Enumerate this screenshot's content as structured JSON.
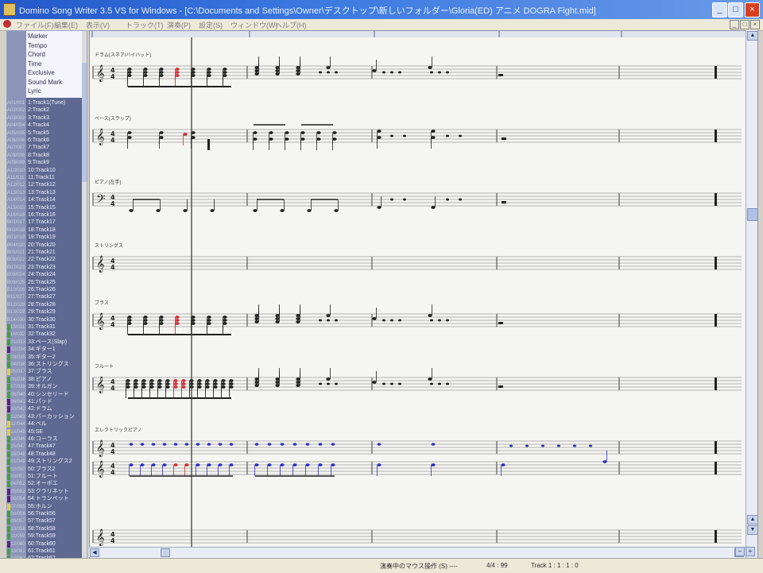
{
  "window": {
    "title": "Domino Song Writer 3.5 VS for Windows - [C:\\Documents and Settings\\Owner\\デスクトップ\\新しいフォルダー\\Gloria(ED) アニメ DOGRA Fight.mid]"
  },
  "window_buttons": {
    "minimize": "_",
    "maximize": "□",
    "close": "×"
  },
  "menu": {
    "items": [
      "ファイル(F)",
      "編集(E)",
      "表示(V)",
      "トラック(T)",
      "演奏(P)",
      "設定(S)",
      "ウィンドウ(W)",
      "ヘルプ(H)"
    ],
    "mdi_buttons": [
      "_",
      "□",
      "×"
    ]
  },
  "conductor": {
    "rows": [
      "Marker",
      "Tempo",
      "Chord",
      "Time",
      "Exclusive",
      "Sound Mark",
      "Lyric"
    ]
  },
  "tracks": [
    {
      "num": "A01/001",
      "label": "1:Track1(Tune)",
      "flag": ""
    },
    {
      "num": "A02/002",
      "label": "2:Track2",
      "flag": ""
    },
    {
      "num": "A03/003",
      "label": "3:Track3",
      "flag": ""
    },
    {
      "num": "A04/004",
      "label": "4:Track4",
      "flag": ""
    },
    {
      "num": "A05/005",
      "label": "5:Track5",
      "flag": ""
    },
    {
      "num": "A06/006",
      "label": "6:Track6",
      "flag": ""
    },
    {
      "num": "A07/007",
      "label": "7:Track7",
      "flag": ""
    },
    {
      "num": "A08/008",
      "label": "8:Track8",
      "flag": ""
    },
    {
      "num": "A09/009",
      "label": "9:Track9",
      "flag": ""
    },
    {
      "num": "A10/010",
      "label": "10:Track10",
      "flag": ""
    },
    {
      "num": "A11/011",
      "label": "11:Track11",
      "flag": ""
    },
    {
      "num": "A12/012",
      "label": "12:Track12",
      "flag": ""
    },
    {
      "num": "A13/013",
      "label": "13:Track13",
      "flag": ""
    },
    {
      "num": "A14/014",
      "label": "14:Track14",
      "flag": ""
    },
    {
      "num": "A15/015",
      "label": "15:Track15",
      "flag": ""
    },
    {
      "num": "A16/016",
      "label": "16:Track16",
      "flag": ""
    },
    {
      "num": "B01/017",
      "label": "17:Track17",
      "flag": ""
    },
    {
      "num": "B02/018",
      "label": "18:Track18",
      "flag": ""
    },
    {
      "num": "B03/019",
      "label": "19:Track19",
      "flag": ""
    },
    {
      "num": "B04/020",
      "label": "20:Track20",
      "flag": ""
    },
    {
      "num": "B05/021",
      "label": "21:Track21",
      "flag": ""
    },
    {
      "num": "B06/022",
      "label": "22:Track22",
      "flag": ""
    },
    {
      "num": "B07/023",
      "label": "23:Track23",
      "flag": ""
    },
    {
      "num": "B08/024",
      "label": "24:Track24",
      "flag": ""
    },
    {
      "num": "B09/025",
      "label": "25:Track25",
      "flag": ""
    },
    {
      "num": "B10/026",
      "label": "26:Track26",
      "flag": ""
    },
    {
      "num": "B11/027",
      "label": "27:Track27",
      "flag": ""
    },
    {
      "num": "B12/028",
      "label": "28:Track28",
      "flag": ""
    },
    {
      "num": "B13/029",
      "label": "29:Track29",
      "flag": ""
    },
    {
      "num": "B14/030",
      "label": "30:Track30",
      "flag": ""
    },
    {
      "num": "B15/031",
      "label": "31:Track31",
      "flag": "#40a040"
    },
    {
      "num": "B16/032",
      "label": "32:Track32",
      "flag": "#40a040"
    },
    {
      "num": "C01/033",
      "label": "33:ベース(Slap)",
      "flag": "#40a040"
    },
    {
      "num": "C02/034",
      "label": "34:ギター1",
      "flag": "#602080"
    },
    {
      "num": "C03/035",
      "label": "35:ギター2",
      "flag": "#40a040"
    },
    {
      "num": "C04/036",
      "label": "36:ストリングス",
      "flag": "#40a040"
    },
    {
      "num": "C05/037",
      "label": "37:ブラス",
      "flag": "#e0d040"
    },
    {
      "num": "C06/038",
      "label": "38:ピアノ",
      "flag": "#40a040"
    },
    {
      "num": "C07/039",
      "label": "39:オルガン",
      "flag": "#40a040"
    },
    {
      "num": "C08/040",
      "label": "40:シンセリード",
      "flag": "#40a040"
    },
    {
      "num": "C09/041",
      "label": "41:パッド",
      "flag": "#602080"
    },
    {
      "num": "C10/042",
      "label": "42:ドラム",
      "flag": "#602080"
    },
    {
      "num": "C11/043",
      "label": "43:パーカッション",
      "flag": "#40a040"
    },
    {
      "num": "C12/044",
      "label": "44:ベル",
      "flag": "#e0d040"
    },
    {
      "num": "C13/045",
      "label": "45:SE",
      "flag": "#e0d040"
    },
    {
      "num": "C14/046",
      "label": "46:コーラス",
      "flag": "#40a040"
    },
    {
      "num": "C15/047",
      "label": "47:Track47",
      "flag": "#40a040"
    },
    {
      "num": "C16/048",
      "label": "48:Track48",
      "flag": "#40a040"
    },
    {
      "num": "D01/049",
      "label": "49:ストリングス2",
      "flag": "#40a040"
    },
    {
      "num": "D02/050",
      "label": "50:ブラス2",
      "flag": "#40a040"
    },
    {
      "num": "D03/051",
      "label": "51:フルート",
      "flag": "#40a040"
    },
    {
      "num": "D04/052",
      "label": "52:オーボエ",
      "flag": "#40a040"
    },
    {
      "num": "D05/053",
      "label": "53:クラリネット",
      "flag": "#602080"
    },
    {
      "num": "D06/054",
      "label": "54:トランペット",
      "flag": "#602080"
    },
    {
      "num": "D07/055",
      "label": "55:ホルン",
      "flag": "#e0d040"
    },
    {
      "num": "D08/056",
      "label": "56:Track56",
      "flag": "#40a040"
    },
    {
      "num": "D09/057",
      "label": "57:Track57",
      "flag": "#40a040"
    },
    {
      "num": "D10/058",
      "label": "58:Track58",
      "flag": "#40a040"
    },
    {
      "num": "D11/059",
      "label": "59:Track59",
      "flag": "#40a040"
    },
    {
      "num": "D12/060",
      "label": "60:Track60",
      "flag": "#602080"
    },
    {
      "num": "D13/061",
      "label": "61:Track61",
      "flag": "#40a040"
    },
    {
      "num": "D14/062",
      "label": "62:Track62",
      "flag": "#40a040"
    }
  ],
  "score": {
    "staves": [
      {
        "name": "ドラム(スネア/ハイハット)",
        "clef": "treble",
        "pattern": "drum"
      },
      {
        "name": "ベース(スラップ)",
        "clef": "treble",
        "pattern": "bass"
      },
      {
        "name": "ピアノ(左手)",
        "clef": "bass",
        "pattern": "beam"
      },
      {
        "name": "ストリングス",
        "clef": "treble",
        "pattern": "empty"
      },
      {
        "name": "ブラス",
        "clef": "treble",
        "pattern": "drum"
      },
      {
        "name": "フルート",
        "clef": "treble",
        "pattern": "dense"
      },
      {
        "name": "エレクトリックピアノ",
        "clef": "grand",
        "pattern": "grand"
      },
      {
        "name": "",
        "clef": "treble",
        "pattern": "empty"
      }
    ],
    "time_signature": "4/4",
    "colors": {
      "cursor": "#303030",
      "accent_note": "#d03030",
      "blue_note": "#3030c0"
    }
  },
  "status": {
    "segments": [
      "演奏中のマウス操作 (S) ----",
      "4/4 : 99",
      "Track 1 : 1 : 1 : 0"
    ]
  },
  "scroll": {
    "up": "▲",
    "down": "▼",
    "left": "◀",
    "right": "▶",
    "zoom_in": "+",
    "zoom_out": "−"
  }
}
